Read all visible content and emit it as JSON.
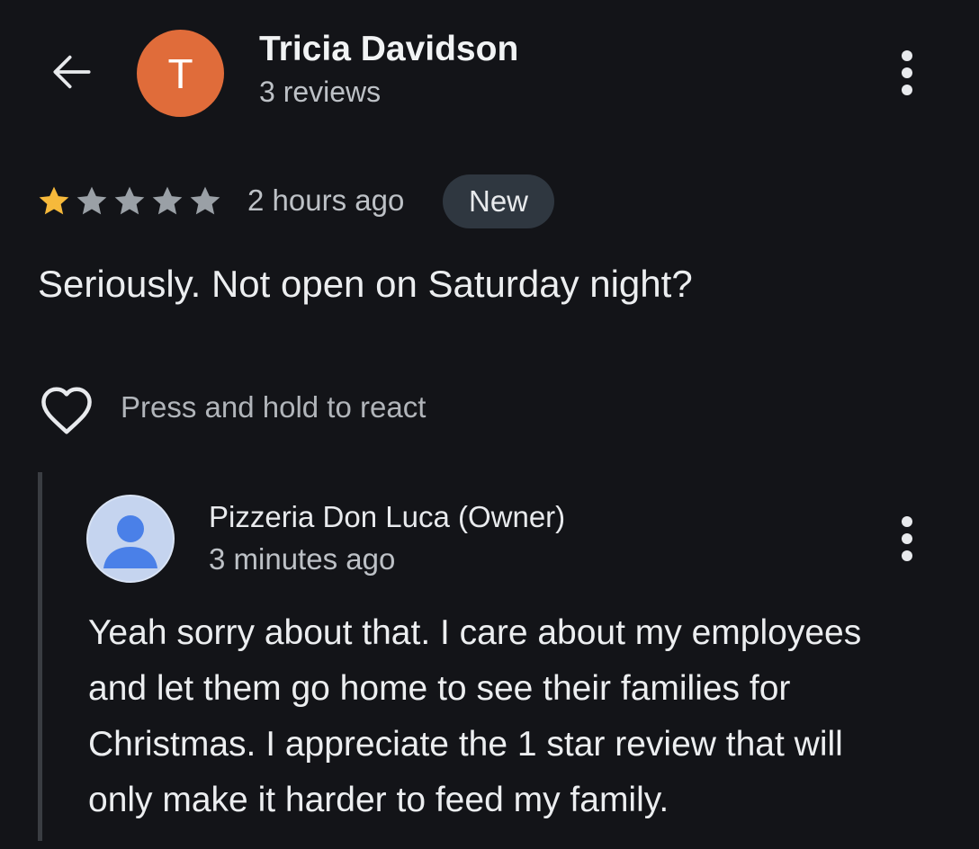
{
  "review": {
    "author": {
      "initial": "T",
      "name": "Tricia Davidson",
      "review_count": "3 reviews",
      "avatar_color": "#e06c3a"
    },
    "rating": 1,
    "rating_max": 5,
    "time": "2 hours ago",
    "badge": "New",
    "text": "Seriously. Not open on Saturday night?",
    "react_hint": "Press and hold to react"
  },
  "reply": {
    "name": "Pizzeria Don Luca (Owner)",
    "time": "3 minutes ago",
    "lines": [
      "Yeah sorry about that. I care about my employees",
      "and let them go home to see their families for",
      "Christmas. I appreciate the 1 star review that will",
      "only make it harder to feed my family."
    ]
  },
  "icons": {
    "back": "arrow-left-icon",
    "more": "more-vertical-icon",
    "heart": "heart-outline-icon",
    "star": "star-icon",
    "avatar": "person-icon"
  },
  "colors": {
    "background": "#131418",
    "star_filled": "#f6b93b",
    "star_empty": "#9aa0a6",
    "badge_bg": "#2f3740"
  }
}
